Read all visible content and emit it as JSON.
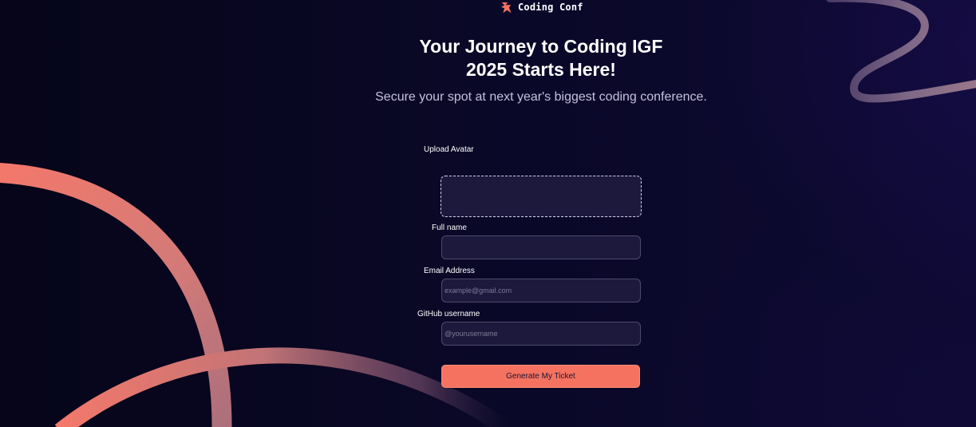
{
  "brand": {
    "name": "Coding Conf",
    "icon": "coding-conf-logo-icon"
  },
  "hero": {
    "headline_line1": "Your Journey to Coding IGF",
    "headline_line2": "2025 Starts Here!",
    "subtitle": "Secure your spot at next year's biggest coding conference."
  },
  "form": {
    "avatar_label": "Upload Avatar",
    "full_name_label": "Full name",
    "full_name_value": "",
    "email_label": "Email Address",
    "email_placeholder": "example@gmail.com",
    "github_label": "GitHub username",
    "github_placeholder": "@yourusername",
    "submit_label": "Generate My Ticket"
  },
  "colors": {
    "background": "#090620",
    "accent": "#f57261",
    "input_background": "#1c193d",
    "input_border": "#4d4a6c",
    "subtitle_text": "#c6c1dc"
  }
}
